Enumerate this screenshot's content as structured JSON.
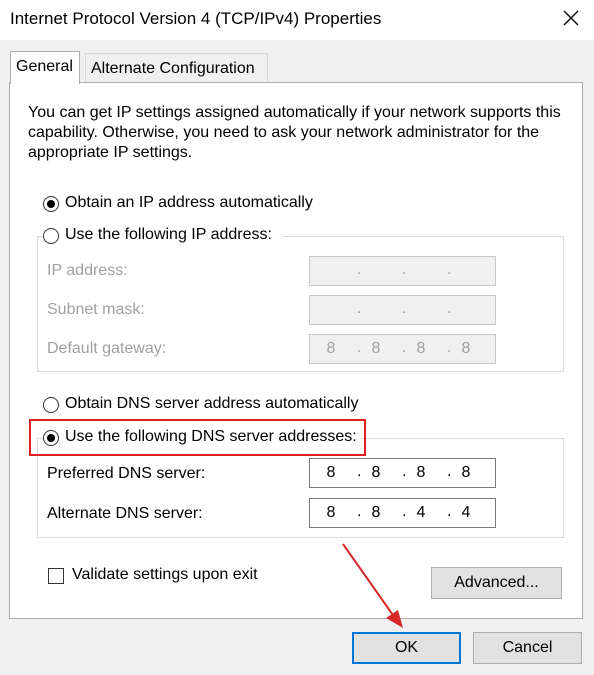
{
  "window": {
    "title": "Internet Protocol Version 4 (TCP/IPv4) Properties"
  },
  "tabs": [
    {
      "label": "General"
    },
    {
      "label": "Alternate Configuration"
    }
  ],
  "general": {
    "description": "You can get IP settings assigned automatically if your network supports this capability. Otherwise, you need to ask your network administrator for the appropriate IP settings.",
    "ip_auto_label": "Obtain an IP address automatically",
    "ip_manual_label": "Use the following IP address:",
    "ip_mode_selected": "auto",
    "ip_fields": [
      {
        "label": "IP address:",
        "octets": [
          "",
          "",
          "",
          ""
        ]
      },
      {
        "label": "Subnet mask:",
        "octets": [
          "",
          "",
          "",
          ""
        ]
      },
      {
        "label": "Default gateway:",
        "octets": [
          "8",
          "8",
          "8",
          "8"
        ]
      }
    ],
    "dns_auto_label": "Obtain DNS server address automatically",
    "dns_manual_label": "Use the following DNS server addresses:",
    "dns_mode_selected": "manual",
    "dns_fields": [
      {
        "label": "Preferred DNS server:",
        "octets": [
          "8",
          "8",
          "8",
          "8"
        ]
      },
      {
        "label": "Alternate DNS server:",
        "octets": [
          "8",
          "8",
          "4",
          "4"
        ]
      }
    ],
    "validate_label": "Validate settings upon exit",
    "validate_checked": false,
    "advanced_label": "Advanced..."
  },
  "buttons": {
    "ok": "OK",
    "cancel": "Cancel"
  },
  "annotation": {
    "highlight_color": "#e02020",
    "arrow_color": "#d62828"
  }
}
